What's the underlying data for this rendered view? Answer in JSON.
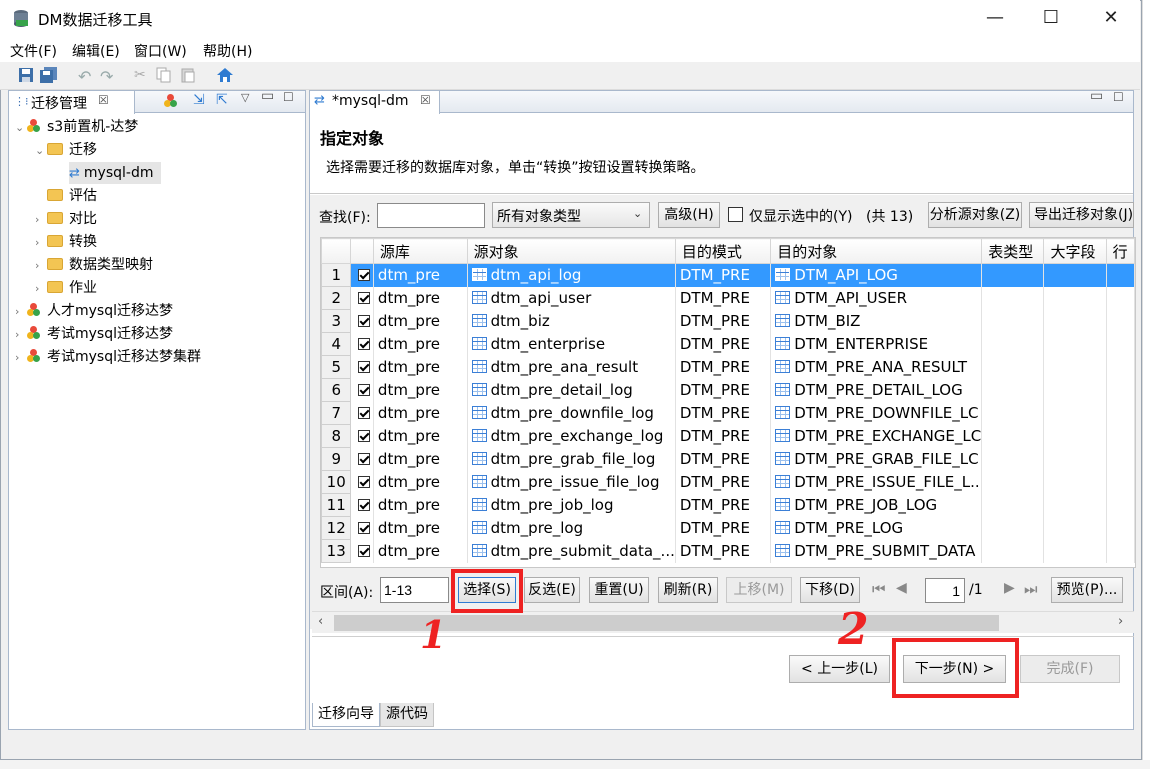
{
  "window": {
    "title": "DM数据迁移工具",
    "min": "—",
    "max": "☐",
    "close": "✕"
  },
  "menu": [
    "文件(F)",
    "编辑(E)",
    "窗口(W)",
    "帮助(H)"
  ],
  "left_panel": {
    "tab_label": "迁移管理",
    "tab_close": "☒",
    "tree": [
      {
        "label": "s3前置机-达梦"
      },
      {
        "label": "迁移"
      },
      {
        "label": "mysql-dm"
      },
      {
        "label": "评估"
      },
      {
        "label": "对比"
      },
      {
        "label": "转换"
      },
      {
        "label": "数据类型映射"
      },
      {
        "label": "作业"
      },
      {
        "label": "人才mysql迁移达梦"
      },
      {
        "label": "考试mysql迁移达梦"
      },
      {
        "label": "考试mysql迁移达梦集群"
      }
    ]
  },
  "editor": {
    "tab_label": "*mysql-dm",
    "tab_close": "☒",
    "heading": "指定对象",
    "description": "选择需要迁移的数据库对象，单击“转换”按钮设置转换策略。",
    "filter": {
      "label": "查找(F):",
      "value": "",
      "type_select": "所有对象类型",
      "advanced": "高级(H)",
      "only_selected": "仅显示选中的(Y)",
      "total": "(共 13)",
      "analyze_btn": "分析源对象(Z)",
      "export_btn": "导出迁移对象(J)"
    },
    "columns": [
      "源库",
      "源对象",
      "目的模式",
      "目的对象",
      "表类型",
      "大字段",
      "行"
    ],
    "rows": [
      {
        "n": "1",
        "src_db": "dtm_pre",
        "src_obj": "dtm_api_log",
        "dst_schema": "DTM_PRE",
        "dst_obj": "DTM_API_LOG"
      },
      {
        "n": "2",
        "src_db": "dtm_pre",
        "src_obj": "dtm_api_user",
        "dst_schema": "DTM_PRE",
        "dst_obj": "DTM_API_USER"
      },
      {
        "n": "3",
        "src_db": "dtm_pre",
        "src_obj": "dtm_biz",
        "dst_schema": "DTM_PRE",
        "dst_obj": "DTM_BIZ"
      },
      {
        "n": "4",
        "src_db": "dtm_pre",
        "src_obj": "dtm_enterprise",
        "dst_schema": "DTM_PRE",
        "dst_obj": "DTM_ENTERPRISE"
      },
      {
        "n": "5",
        "src_db": "dtm_pre",
        "src_obj": "dtm_pre_ana_result",
        "dst_schema": "DTM_PRE",
        "dst_obj": "DTM_PRE_ANA_RESULT"
      },
      {
        "n": "6",
        "src_db": "dtm_pre",
        "src_obj": "dtm_pre_detail_log",
        "dst_schema": "DTM_PRE",
        "dst_obj": "DTM_PRE_DETAIL_LOG"
      },
      {
        "n": "7",
        "src_db": "dtm_pre",
        "src_obj": "dtm_pre_downfile_log",
        "dst_schema": "DTM_PRE",
        "dst_obj": "DTM_PRE_DOWNFILE_LC"
      },
      {
        "n": "8",
        "src_db": "dtm_pre",
        "src_obj": "dtm_pre_exchange_log",
        "dst_schema": "DTM_PRE",
        "dst_obj": "DTM_PRE_EXCHANGE_LC"
      },
      {
        "n": "9",
        "src_db": "dtm_pre",
        "src_obj": "dtm_pre_grab_file_log",
        "dst_schema": "DTM_PRE",
        "dst_obj": "DTM_PRE_GRAB_FILE_LC"
      },
      {
        "n": "10",
        "src_db": "dtm_pre",
        "src_obj": "dtm_pre_issue_file_log",
        "dst_schema": "DTM_PRE",
        "dst_obj": "DTM_PRE_ISSUE_FILE_L.."
      },
      {
        "n": "11",
        "src_db": "dtm_pre",
        "src_obj": "dtm_pre_job_log",
        "dst_schema": "DTM_PRE",
        "dst_obj": "DTM_PRE_JOB_LOG"
      },
      {
        "n": "12",
        "src_db": "dtm_pre",
        "src_obj": "dtm_pre_log",
        "dst_schema": "DTM_PRE",
        "dst_obj": "DTM_PRE_LOG"
      },
      {
        "n": "13",
        "src_db": "dtm_pre",
        "src_obj": "dtm_pre_submit_data_...",
        "dst_schema": "DTM_PRE",
        "dst_obj": "DTM_PRE_SUBMIT_DATA"
      }
    ],
    "range": {
      "label": "区间(A):",
      "value": "1-13",
      "select": "选择(S)",
      "invert": "反选(E)",
      "reset": "重置(U)",
      "refresh": "刷新(R)",
      "up": "上移(M)",
      "down": "下移(D)",
      "page": "1",
      "page_total": "/1",
      "preview": "预览(P)..."
    },
    "wizard": {
      "prev": "< 上一步(L)",
      "next": "下一步(N) >",
      "finish": "完成(F)"
    },
    "bottom_tabs": [
      "迁移向导",
      "源代码"
    ]
  },
  "annotations": {
    "one": "1",
    "two": "2"
  },
  "colors": {
    "selection": "#3399ff",
    "highlight": "#ee2222"
  }
}
